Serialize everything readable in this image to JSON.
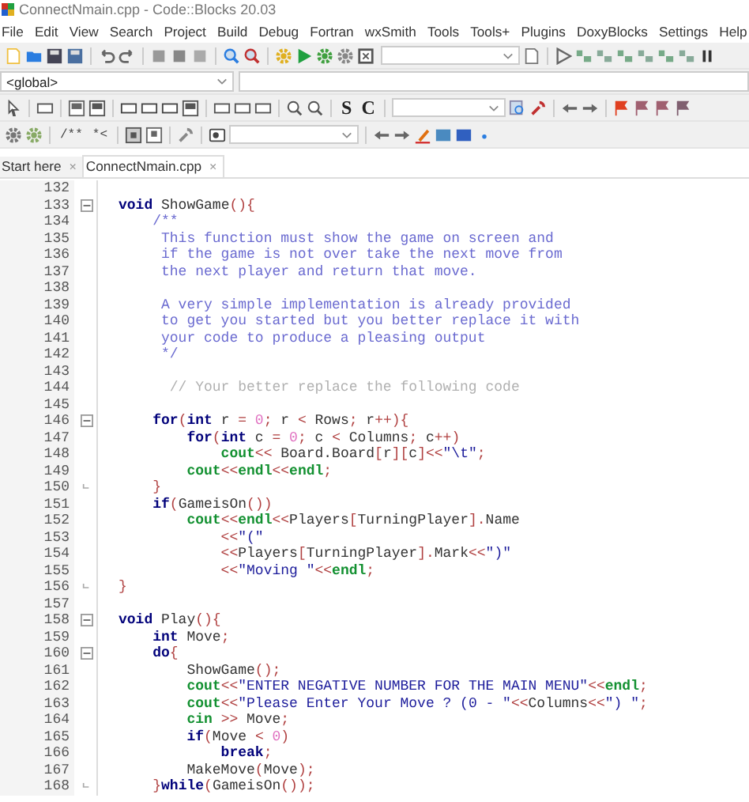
{
  "window": {
    "title": "ConnectNmain.cpp - Code::Blocks 20.03"
  },
  "menu": [
    "File",
    "Edit",
    "View",
    "Search",
    "Project",
    "Build",
    "Debug",
    "Fortran",
    "wxSmith",
    "Tools",
    "Tools+",
    "Plugins",
    "DoxyBlocks",
    "Settings",
    "Help"
  ],
  "scope_bar": {
    "scope": "<global>"
  },
  "toolbar_2": {
    "labels": [
      "S",
      "C"
    ]
  },
  "toolbar_3": {
    "labels": [
      "/**",
      "*<"
    ]
  },
  "tabs": [
    {
      "label": "Start here",
      "close": "×",
      "selected": false
    },
    {
      "label": "ConnectNmain.cpp",
      "close": "×",
      "selected": true
    }
  ],
  "editor": {
    "lines": [
      {
        "number": "132",
        "kind": "plain"
      },
      {
        "number": "133",
        "kind": "fold_start",
        "tokens": [
          {
            "kind": "kw",
            "text": "void"
          },
          {
            "kind": "id",
            "text": " ShowGame"
          },
          {
            "kind": "op",
            "text": "(){"
          }
        ]
      },
      {
        "number": "134",
        "kind": "plain",
        "tokens": [
          {
            "kind": "cm",
            "text": "    /**"
          }
        ]
      },
      {
        "number": "135",
        "kind": "plain",
        "tokens": [
          {
            "kind": "cm",
            "text": "     This function must show the game on screen and"
          }
        ]
      },
      {
        "number": "136",
        "kind": "plain",
        "tokens": [
          {
            "kind": "cm",
            "text": "     if the game is not over take the next move from"
          }
        ]
      },
      {
        "number": "137",
        "kind": "plain",
        "tokens": [
          {
            "kind": "cm",
            "text": "     the next player and return that move."
          }
        ]
      },
      {
        "number": "138",
        "kind": "plain"
      },
      {
        "number": "139",
        "kind": "plain",
        "tokens": [
          {
            "kind": "cm",
            "text": "     A very simple implementation is already provided"
          }
        ]
      },
      {
        "number": "140",
        "kind": "plain",
        "tokens": [
          {
            "kind": "cm",
            "text": "     to get you started but you better replace it with"
          }
        ]
      },
      {
        "number": "141",
        "kind": "plain",
        "tokens": [
          {
            "kind": "cm",
            "text": "     your code to produce a pleasing output"
          }
        ]
      },
      {
        "number": "142",
        "kind": "plain",
        "tokens": [
          {
            "kind": "cm",
            "text": "     */"
          }
        ]
      },
      {
        "number": "143",
        "kind": "plain"
      },
      {
        "number": "144",
        "kind": "plain",
        "tokens": [
          {
            "kind": "lc",
            "text": "      // Your better replace the following code"
          }
        ]
      },
      {
        "number": "145",
        "kind": "plain"
      },
      {
        "number": "146",
        "kind": "fold_start",
        "tokens": [
          {
            "kind": "kw",
            "text": "    for"
          },
          {
            "kind": "op",
            "text": "("
          },
          {
            "kind": "kw",
            "text": "int"
          },
          {
            "kind": "id",
            "text": " r "
          },
          {
            "kind": "op",
            "text": "="
          },
          {
            "kind": "num",
            "text": " 0"
          },
          {
            "kind": "op",
            "text": ";"
          },
          {
            "kind": "id",
            "text": " r "
          },
          {
            "kind": "op",
            "text": "<"
          },
          {
            "kind": "id",
            "text": " Rows"
          },
          {
            "kind": "op",
            "text": ";"
          },
          {
            "kind": "id",
            "text": " r"
          },
          {
            "kind": "op",
            "text": "++){"
          }
        ]
      },
      {
        "number": "147",
        "kind": "plain",
        "tokens": [
          {
            "kind": "kw",
            "text": "        for"
          },
          {
            "kind": "op",
            "text": "("
          },
          {
            "kind": "kw",
            "text": "int"
          },
          {
            "kind": "id",
            "text": " c "
          },
          {
            "kind": "op",
            "text": "="
          },
          {
            "kind": "num",
            "text": " 0"
          },
          {
            "kind": "op",
            "text": ";"
          },
          {
            "kind": "id",
            "text": " c "
          },
          {
            "kind": "op",
            "text": "<"
          },
          {
            "kind": "id",
            "text": " Columns"
          },
          {
            "kind": "op",
            "text": ";"
          },
          {
            "kind": "id",
            "text": " c"
          },
          {
            "kind": "op",
            "text": "++)"
          }
        ]
      },
      {
        "number": "148",
        "kind": "plain",
        "tokens": [
          {
            "kind": "lib",
            "text": "            cout"
          },
          {
            "kind": "op",
            "text": "<<"
          },
          {
            "kind": "id",
            "text": " Board.Board"
          },
          {
            "kind": "op",
            "text": "["
          },
          {
            "kind": "id",
            "text": "r"
          },
          {
            "kind": "op",
            "text": "]["
          },
          {
            "kind": "id",
            "text": "c"
          },
          {
            "kind": "op",
            "text": "]<<"
          },
          {
            "kind": "str",
            "text": "\"\\t\""
          },
          {
            "kind": "op",
            "text": ";"
          }
        ]
      },
      {
        "number": "149",
        "kind": "plain",
        "tokens": [
          {
            "kind": "lib",
            "text": "        cout"
          },
          {
            "kind": "op",
            "text": "<<"
          },
          {
            "kind": "lib",
            "text": "endl"
          },
          {
            "kind": "op",
            "text": "<<"
          },
          {
            "kind": "lib",
            "text": "endl"
          },
          {
            "kind": "op",
            "text": ";"
          }
        ]
      },
      {
        "number": "150",
        "kind": "fold_end",
        "tokens": [
          {
            "kind": "op",
            "text": "    }"
          }
        ]
      },
      {
        "number": "151",
        "kind": "plain",
        "tokens": [
          {
            "kind": "kw",
            "text": "    if"
          },
          {
            "kind": "op",
            "text": "("
          },
          {
            "kind": "id",
            "text": "GameisOn"
          },
          {
            "kind": "op",
            "text": "())"
          }
        ]
      },
      {
        "number": "152",
        "kind": "plain",
        "tokens": [
          {
            "kind": "lib",
            "text": "        cout"
          },
          {
            "kind": "op",
            "text": "<<"
          },
          {
            "kind": "lib",
            "text": "endl"
          },
          {
            "kind": "op",
            "text": "<<"
          },
          {
            "kind": "id",
            "text": "Players"
          },
          {
            "kind": "op",
            "text": "["
          },
          {
            "kind": "id",
            "text": "TurningPlayer"
          },
          {
            "kind": "op",
            "text": "]."
          },
          {
            "kind": "id",
            "text": "Name"
          }
        ]
      },
      {
        "number": "153",
        "kind": "plain",
        "tokens": [
          {
            "kind": "op",
            "text": "            <<"
          },
          {
            "kind": "str",
            "text": "\"(\""
          }
        ]
      },
      {
        "number": "154",
        "kind": "plain",
        "tokens": [
          {
            "kind": "op",
            "text": "            <<"
          },
          {
            "kind": "id",
            "text": "Players"
          },
          {
            "kind": "op",
            "text": "["
          },
          {
            "kind": "id",
            "text": "TurningPlayer"
          },
          {
            "kind": "op",
            "text": "]."
          },
          {
            "kind": "id",
            "text": "Mark"
          },
          {
            "kind": "op",
            "text": "<<"
          },
          {
            "kind": "str",
            "text": "\")\""
          }
        ]
      },
      {
        "number": "155",
        "kind": "plain",
        "tokens": [
          {
            "kind": "op",
            "text": "            <<"
          },
          {
            "kind": "str",
            "text": "\"Moving \""
          },
          {
            "kind": "op",
            "text": "<<"
          },
          {
            "kind": "lib",
            "text": "endl"
          },
          {
            "kind": "op",
            "text": ";"
          }
        ]
      },
      {
        "number": "156",
        "kind": "fold_end",
        "tokens": [
          {
            "kind": "op",
            "text": "}"
          }
        ]
      },
      {
        "number": "157",
        "kind": "plain"
      },
      {
        "number": "158",
        "kind": "fold_start",
        "tokens": [
          {
            "kind": "kw",
            "text": "void"
          },
          {
            "kind": "id",
            "text": " Play"
          },
          {
            "kind": "op",
            "text": "(){"
          }
        ]
      },
      {
        "number": "159",
        "kind": "plain",
        "tokens": [
          {
            "kind": "kw",
            "text": "    int"
          },
          {
            "kind": "id",
            "text": " Move"
          },
          {
            "kind": "op",
            "text": ";"
          }
        ]
      },
      {
        "number": "160",
        "kind": "fold_start",
        "tokens": [
          {
            "kind": "kw",
            "text": "    do"
          },
          {
            "kind": "op",
            "text": "{"
          }
        ]
      },
      {
        "number": "161",
        "kind": "plain",
        "tokens": [
          {
            "kind": "id",
            "text": "        ShowGame"
          },
          {
            "kind": "op",
            "text": "();"
          }
        ]
      },
      {
        "number": "162",
        "kind": "plain",
        "tokens": [
          {
            "kind": "lib",
            "text": "        cout"
          },
          {
            "kind": "op",
            "text": "<<"
          },
          {
            "kind": "str",
            "text": "\"ENTER NEGATIVE NUMBER FOR THE MAIN MENU\""
          },
          {
            "kind": "op",
            "text": "<<"
          },
          {
            "kind": "lib",
            "text": "endl"
          },
          {
            "kind": "op",
            "text": ";"
          }
        ]
      },
      {
        "number": "163",
        "kind": "plain",
        "tokens": [
          {
            "kind": "lib",
            "text": "        cout"
          },
          {
            "kind": "op",
            "text": "<<"
          },
          {
            "kind": "str",
            "text": "\"Please Enter Your Move ? (0 - \""
          },
          {
            "kind": "op",
            "text": "<<"
          },
          {
            "kind": "id",
            "text": "Columns"
          },
          {
            "kind": "op",
            "text": "<<"
          },
          {
            "kind": "str",
            "text": "\") \""
          },
          {
            "kind": "op",
            "text": ";"
          }
        ]
      },
      {
        "number": "164",
        "kind": "plain",
        "tokens": [
          {
            "kind": "lib",
            "text": "        cin"
          },
          {
            "kind": "op",
            "text": " >>"
          },
          {
            "kind": "id",
            "text": " Move"
          },
          {
            "kind": "op",
            "text": ";"
          }
        ]
      },
      {
        "number": "165",
        "kind": "plain",
        "tokens": [
          {
            "kind": "kw",
            "text": "        if"
          },
          {
            "kind": "op",
            "text": "("
          },
          {
            "kind": "id",
            "text": "Move "
          },
          {
            "kind": "op",
            "text": "<"
          },
          {
            "kind": "num",
            "text": " 0"
          },
          {
            "kind": "op",
            "text": ")"
          }
        ]
      },
      {
        "number": "166",
        "kind": "plain",
        "tokens": [
          {
            "kind": "kw",
            "text": "            break"
          },
          {
            "kind": "op",
            "text": ";"
          }
        ]
      },
      {
        "number": "167",
        "kind": "plain",
        "tokens": [
          {
            "kind": "id",
            "text": "        MakeMove"
          },
          {
            "kind": "op",
            "text": "("
          },
          {
            "kind": "id",
            "text": "Move"
          },
          {
            "kind": "op",
            "text": ");"
          }
        ]
      },
      {
        "number": "168",
        "kind": "fold_end",
        "tokens": [
          {
            "kind": "op",
            "text": "    }"
          },
          {
            "kind": "kw",
            "text": "while"
          },
          {
            "kind": "op",
            "text": "("
          },
          {
            "kind": "id",
            "text": "GameisOn"
          },
          {
            "kind": "op",
            "text": "());"
          }
        ]
      }
    ]
  }
}
